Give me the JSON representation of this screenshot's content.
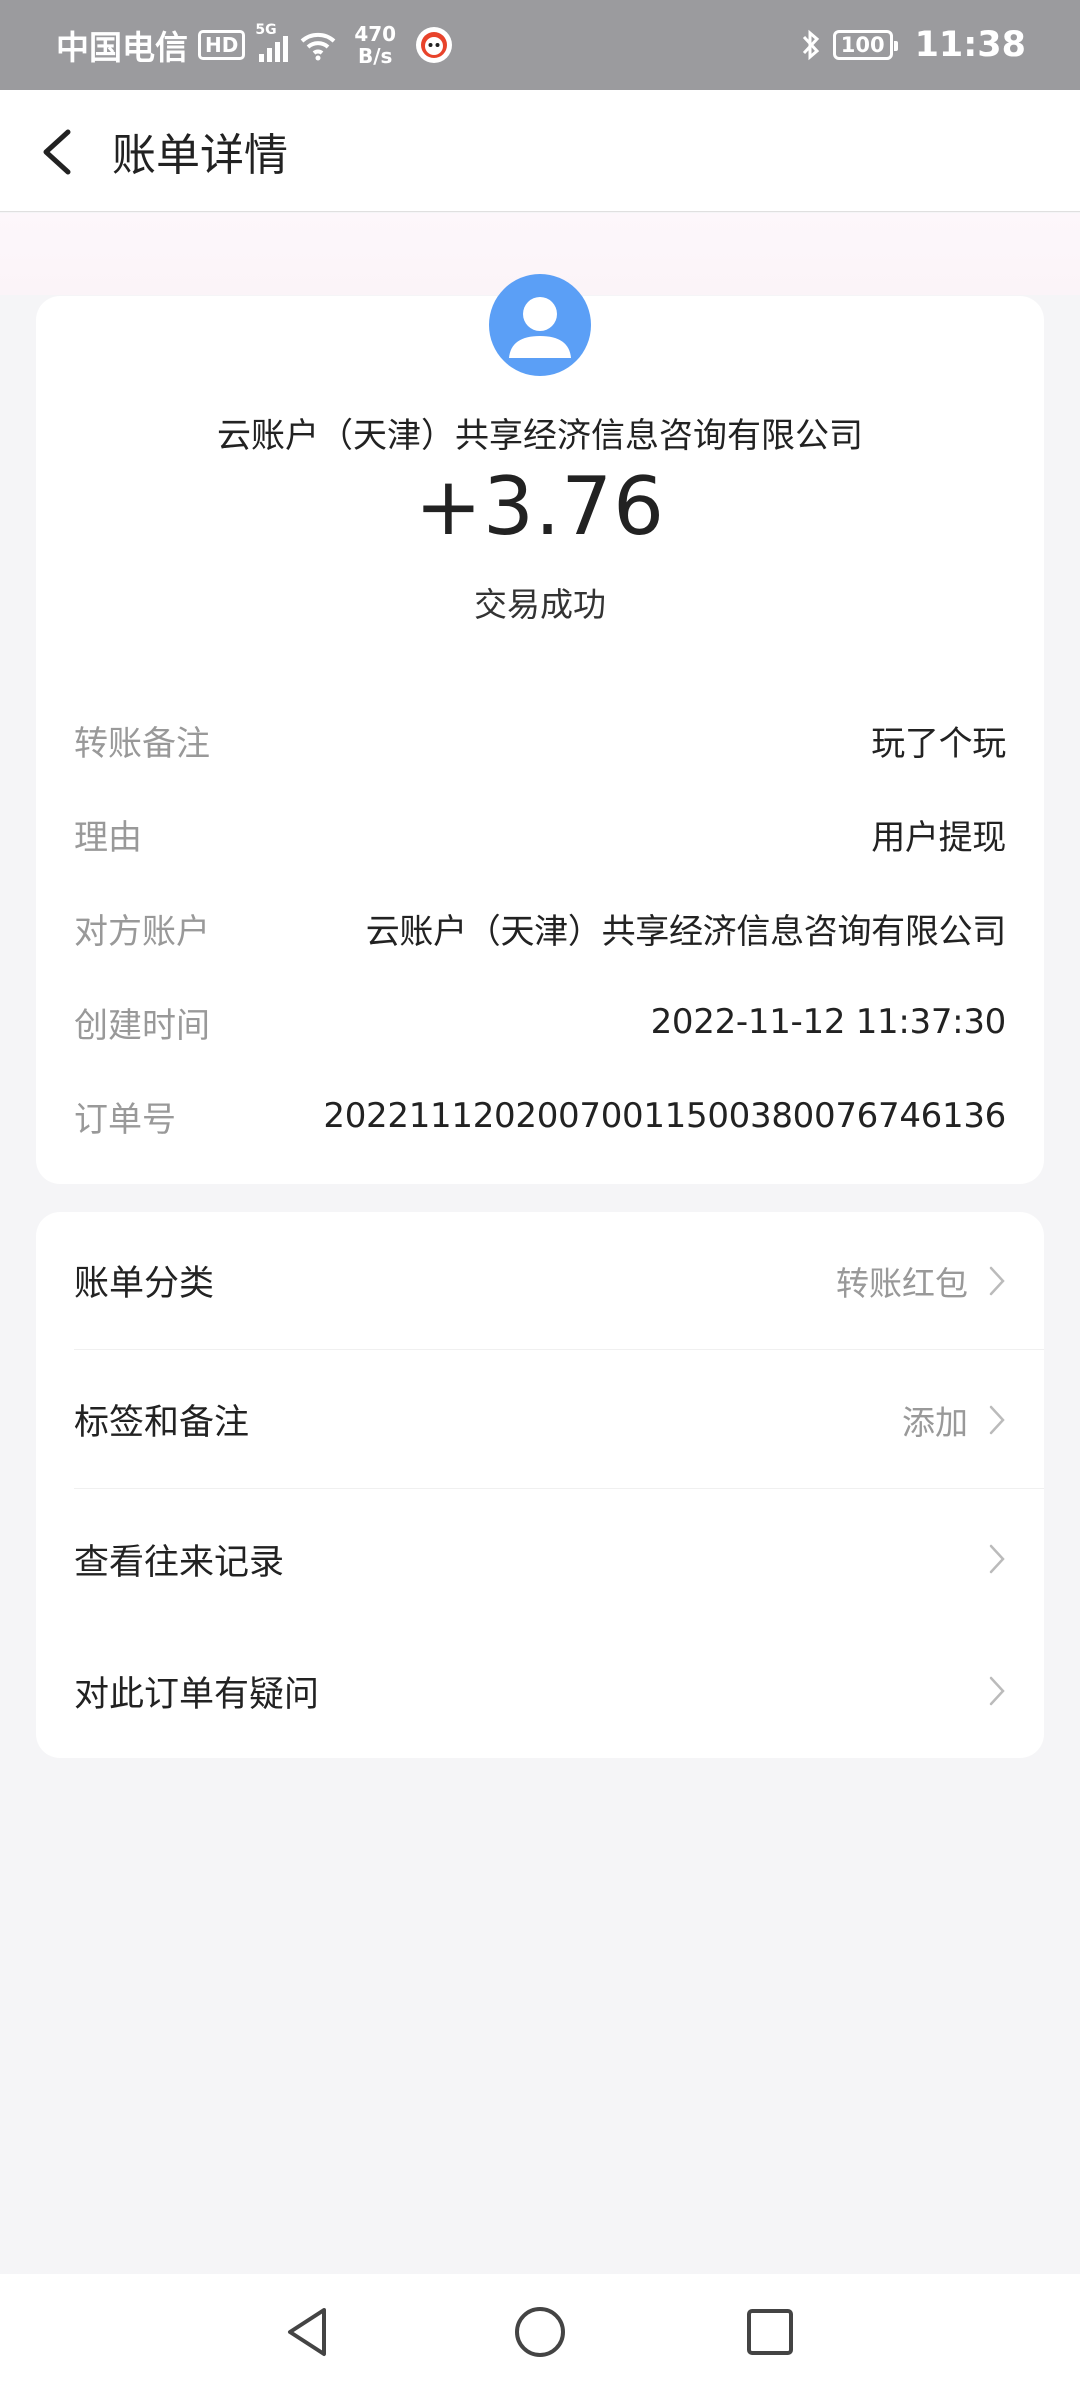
{
  "status_bar": {
    "carrier": "中国电信",
    "hd": "HD",
    "network_type": "5G",
    "speed_value": "470",
    "speed_unit": "B/s",
    "battery": "100",
    "time": "11:38",
    "icons": [
      "signal-icon",
      "wifi-icon",
      "app-notification-icon",
      "bluetooth-icon",
      "battery-icon"
    ]
  },
  "header": {
    "title": "账单详情",
    "back_icon": "chevron-left-icon"
  },
  "transaction": {
    "counterparty": "云账户（天津）共享经济信息咨询有限公司",
    "amount": "+3.76",
    "status": "交易成功",
    "avatar_color": "#5b9ff6"
  },
  "details": [
    {
      "label": "转账备注",
      "value": "玩了个玩"
    },
    {
      "label": "理由",
      "value": "用户提现"
    },
    {
      "label": "对方账户",
      "value": "云账户（天津）共享经济信息咨询有限公司"
    },
    {
      "label": "创建时间",
      "value": "2022-11-12 11:37:30"
    },
    {
      "label": "订单号",
      "value": "20221112020070011500380076746136"
    }
  ],
  "actions": [
    {
      "label": "账单分类",
      "value": "转账红包"
    },
    {
      "label": "标签和备注",
      "value": "添加"
    },
    {
      "label": "查看往来记录",
      "value": ""
    },
    {
      "label": "对此订单有疑问",
      "value": ""
    }
  ],
  "nav": [
    "back-triangle-icon",
    "home-circle-icon",
    "recents-square-icon"
  ]
}
